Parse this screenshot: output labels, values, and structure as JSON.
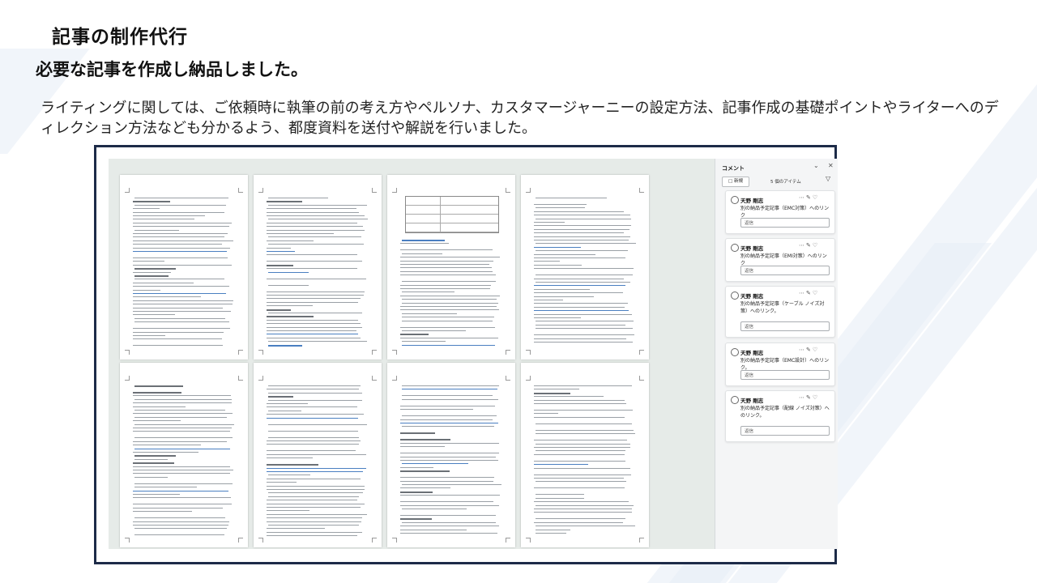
{
  "slide": {
    "title": "記事の制作代行",
    "subtitle": "必要な記事を作成し納品しました。",
    "description": "ライティングに関しては、ご依頼時に執筆の前の考え方やペルソナ、カスタマージャーニーの設定方法、記事作成の基礎ポイントやライターへのディレクション方法なども分かるよう、都度資料を送付や解説を行いました。"
  },
  "comments_panel": {
    "title": "コメント",
    "collapse_icon": "chevron-down-icon",
    "close_icon": "close-icon",
    "new_button": "新規",
    "item_count": "5 個のアイテム",
    "filter_icon": "filter-icon",
    "reply_placeholder": "返信",
    "comments": [
      {
        "author": "天野 剛志",
        "text": "別の納品予定記事（EMC対策）へのリンク"
      },
      {
        "author": "天野 剛志",
        "text": "別の納品予定記事（EMI対策）へのリンク"
      },
      {
        "author": "天野 剛志",
        "text": "別の納品予定記事（ケーブル ノイズ対策）へのリンク。"
      },
      {
        "author": "天野 剛志",
        "text": "別の納品予定記事（EMC設計）へのリンク。"
      },
      {
        "author": "天野 剛志",
        "text": "別の納品予定記事（配線 ノイズ対策）へのリンク。"
      }
    ]
  },
  "colors": {
    "frame_border": "#1d2b48",
    "document_background": "#e6ebe8",
    "panel_background": "#f4f5f6",
    "link_blue": "#4a7fc1"
  }
}
